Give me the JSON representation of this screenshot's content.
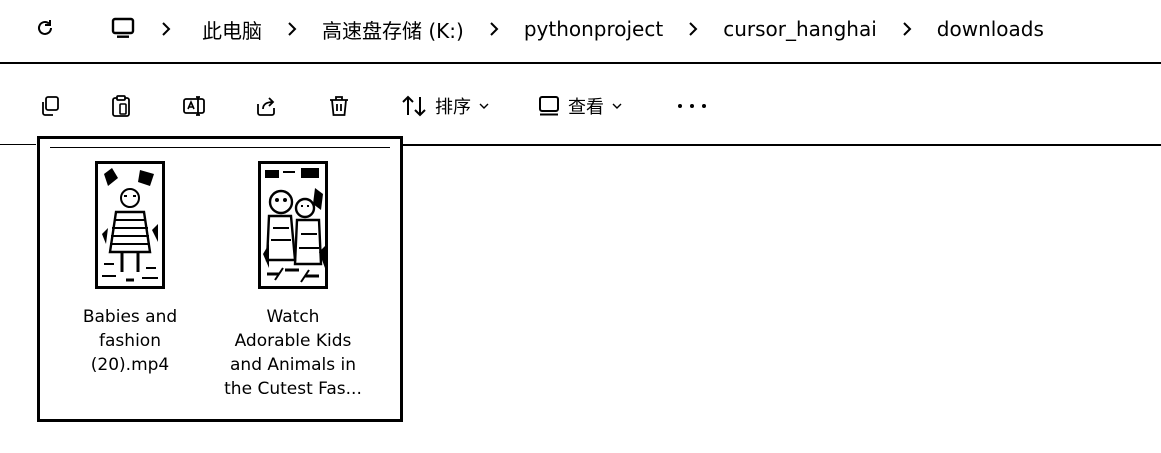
{
  "address_bar": {
    "refresh_icon": "refresh-icon",
    "root_icon": "computer-icon",
    "breadcrumbs": [
      "此电脑",
      "高速盘存储 (K:)",
      "pythonproject",
      "cursor_hanghai",
      "downloads"
    ]
  },
  "command_bar": {
    "tools": [
      "copy-icon",
      "paste-icon",
      "rename-icon",
      "share-icon",
      "delete-icon"
    ],
    "sort_label": "排序",
    "view_label": "查看",
    "more_icon": "more-icon"
  },
  "files": [
    {
      "name": "Babies and fashion (20).mp4",
      "display": "Babies and\nfashion\n(20).mp4"
    },
    {
      "name": "Watch Adorable Kids and Animals in the Cutest Fas...",
      "display": "Watch\nAdorable Kids\nand Animals in\nthe Cutest Fas..."
    }
  ]
}
